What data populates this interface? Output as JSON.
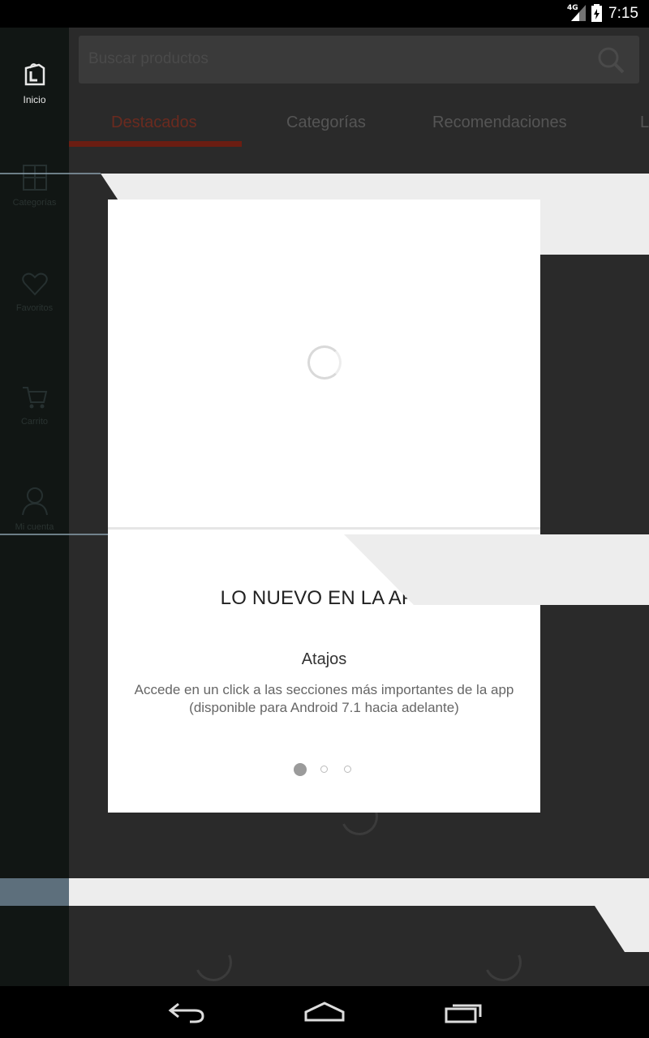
{
  "status_bar": {
    "network": "4G",
    "time": "7:15"
  },
  "rail": {
    "items": [
      {
        "label": "Inicio",
        "icon": "shopping-bag-icon"
      },
      {
        "label": "Categorías",
        "icon": "grid-icon"
      },
      {
        "label": "Favoritos",
        "icon": "heart-icon"
      },
      {
        "label": "Carrito",
        "icon": "cart-icon"
      },
      {
        "label": "Mi cuenta",
        "icon": "user-icon"
      }
    ]
  },
  "search": {
    "placeholder": "Buscar productos",
    "icon": "search-icon"
  },
  "tabs": [
    {
      "label": "Destacados"
    },
    {
      "label": "Categorías"
    },
    {
      "label": "Recomendaciones"
    },
    {
      "label": "L"
    }
  ],
  "modal": {
    "title": "LO NUEVO EN LA APP",
    "subtitle": "Atajos",
    "description_line1": "Accede en un click a las secciones más importantes de la app",
    "description_line2": "(disponible para Android 7.1 hacia adelante)",
    "pages_total": 3,
    "current_page": 1
  },
  "colors": {
    "active_tab": "#6b1d12",
    "overlay": "#2a2a2a",
    "rail_bg": "#111614"
  }
}
